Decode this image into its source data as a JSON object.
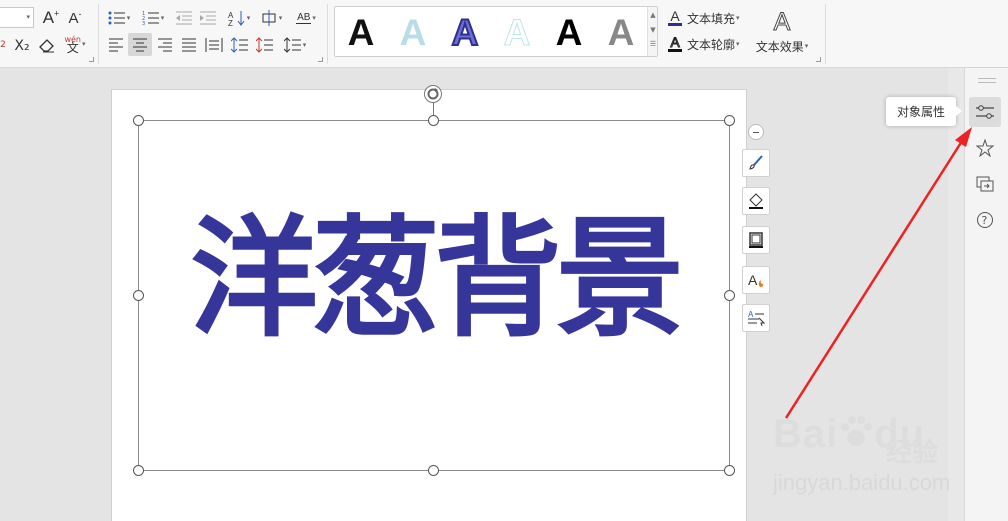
{
  "ribbon": {
    "font_size_value": "",
    "superscript_fragment": "2",
    "subscript_label": "X₂",
    "pinyin_label": "wén",
    "text_fill_label": "文本填充",
    "text_outline_label": "文本轮廓",
    "text_effect_label": "文本效果",
    "char_spacing_label": "AB",
    "gallery_letter": "A"
  },
  "canvas": {
    "wordart_text": "洋葱背景",
    "wordart_color": "#36359a"
  },
  "task_pane": {
    "tooltip": "对象属性"
  },
  "watermark": {
    "brand": "Bai",
    "brand2": "du",
    "cn": "经验",
    "url": "jingyan.baidu.com"
  },
  "colors": {
    "annotation_arrow": "#ee2222",
    "accent_blue": "#36359a"
  }
}
